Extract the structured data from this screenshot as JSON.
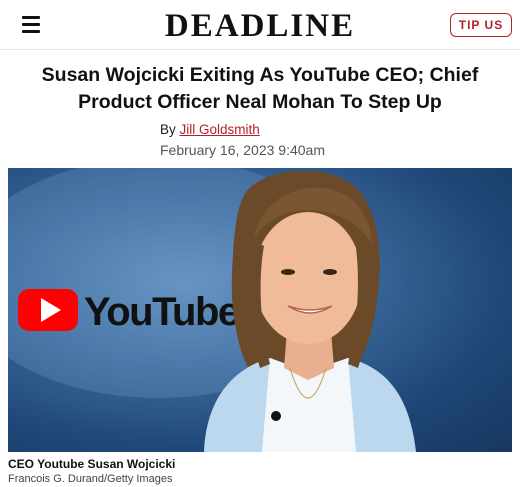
{
  "site": {
    "logo": "DEADLINE",
    "tip_label": "TIP US"
  },
  "article": {
    "headline": "Susan Wojcicki Exiting As YouTube CEO; Chief Product Officer Neal Mohan To Step Up",
    "by_prefix": "By",
    "author": "Jill Goldsmith",
    "date": "February 16, 2023 9:40am"
  },
  "image": {
    "logo_text": "YouTube",
    "caption": "CEO Youtube Susan Wojcicki",
    "credit": "Francois G. Durand/Getty Images"
  },
  "colors": {
    "accent": "#b0232a",
    "youtube_red": "#ff0000",
    "hero_blue": "#3b6a9c"
  },
  "icons": [
    "hamburger-menu-icon",
    "youtube-play-icon"
  ]
}
